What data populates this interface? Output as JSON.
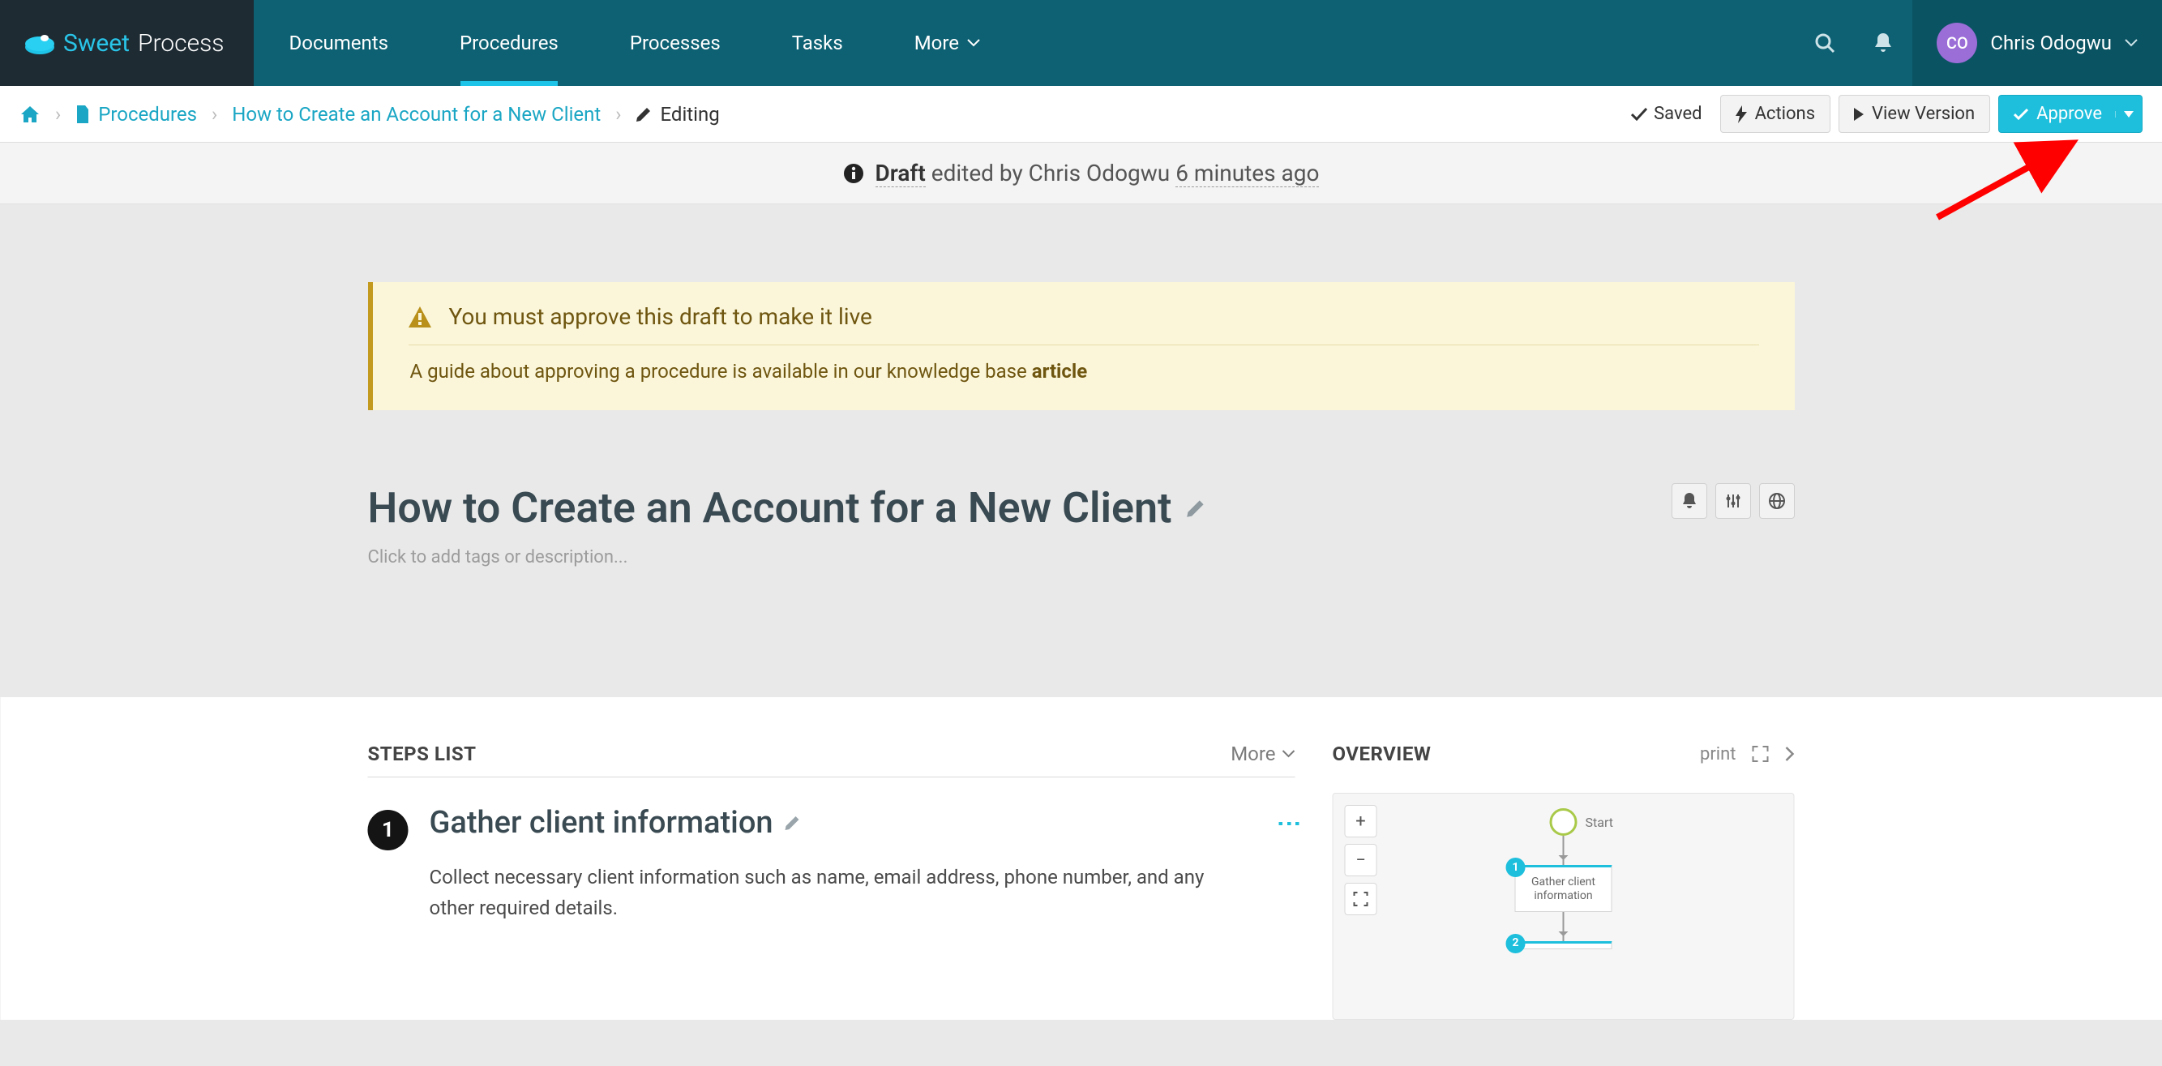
{
  "nav": {
    "logo_sweet": "Sweet",
    "logo_process": "Process",
    "links": [
      "Documents",
      "Procedures",
      "Processes",
      "Tasks"
    ],
    "more": "More",
    "active_index": 1
  },
  "user": {
    "initials": "CO",
    "name": "Chris Odogwu"
  },
  "breadcrumb": {
    "procedures": "Procedures",
    "doc_title": "How to Create an Account for a New Client",
    "editing": "Editing"
  },
  "subbar": {
    "saved": "Saved",
    "actions": "Actions",
    "view_version": "View Version",
    "approve": "Approve"
  },
  "draft_banner": {
    "draft": "Draft",
    "edited_by": "edited by Chris Odogwu",
    "time": "6 minutes ago"
  },
  "notice": {
    "title": "You must approve this draft to make it live",
    "body_prefix": "A guide about approving a procedure is available in our knowledge base ",
    "article": "article"
  },
  "doc": {
    "title": "How to Create an Account for a New Client",
    "tags_placeholder": "Click to add tags or description..."
  },
  "steps": {
    "heading": "STEPS LIST",
    "more": "More",
    "items": [
      {
        "num": "1",
        "title": "Gather client information",
        "desc": "Collect necessary client information such as name, email address, phone number, and any other required details."
      }
    ]
  },
  "overview": {
    "heading": "OVERVIEW",
    "print": "print",
    "start_label": "Start",
    "node1_label": "Gather client information",
    "badge1": "1",
    "badge2": "2"
  }
}
